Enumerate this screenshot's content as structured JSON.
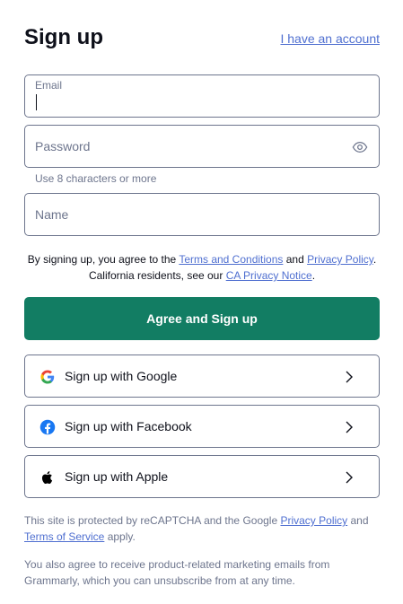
{
  "header": {
    "title": "Sign up",
    "login_link": "I have an account"
  },
  "form": {
    "email": {
      "label": "Email",
      "value": ""
    },
    "password": {
      "label": "Password",
      "value": "",
      "hint": "Use 8 characters or more"
    },
    "name": {
      "label": "Name",
      "value": ""
    }
  },
  "terms": {
    "prefix": "By signing up, you agree to the ",
    "terms_link": "Terms and Conditions",
    "and": " and ",
    "privacy_link": "Privacy Policy",
    "middle": ". California residents, see our ",
    "ca_link": "CA Privacy Notice",
    "suffix": "."
  },
  "primary_button": "Agree and Sign up",
  "social": [
    {
      "label": "Sign up with Google",
      "icon": "google-icon"
    },
    {
      "label": "Sign up with Facebook",
      "icon": "facebook-icon"
    },
    {
      "label": "Sign up with Apple",
      "icon": "apple-icon"
    }
  ],
  "recaptcha": {
    "prefix": "This site is protected by reCAPTCHA and the Google ",
    "privacy_link": "Privacy Policy",
    "and": " and ",
    "tos_link": "Terms of Service",
    "suffix": " apply."
  },
  "marketing": "You also agree to receive product-related marketing emails from Grammarly, which you can unsubscribe from at any time.",
  "colors": {
    "primary": "#127d63",
    "link": "#4f6fd0",
    "border": "#6d758d",
    "text": "#0e101a"
  }
}
